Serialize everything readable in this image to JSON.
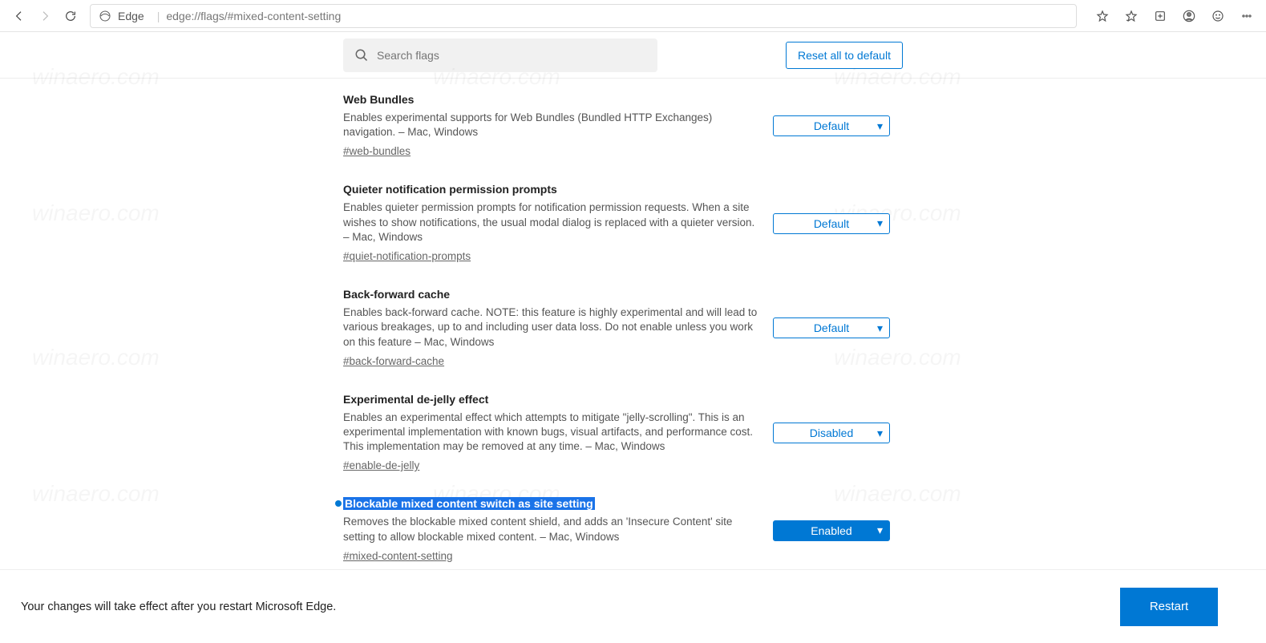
{
  "chrome": {
    "browser_label": "Edge",
    "url": "edge://flags/#mixed-content-setting"
  },
  "toolbar": {
    "search_placeholder": "Search flags",
    "reset_label": "Reset all to default"
  },
  "flags": [
    {
      "title": "Web Bundles",
      "desc": "Enables experimental supports for Web Bundles (Bundled HTTP Exchanges) navigation. – Mac, Windows",
      "anchor": "#web-bundles",
      "value": "Default",
      "highlight": false,
      "enabled_style": false
    },
    {
      "title": "Quieter notification permission prompts",
      "desc": "Enables quieter permission prompts for notification permission requests. When a site wishes to show notifications, the usual modal dialog is replaced with a quieter version. – Mac, Windows",
      "anchor": "#quiet-notification-prompts",
      "value": "Default",
      "highlight": false,
      "enabled_style": false
    },
    {
      "title": "Back-forward cache",
      "desc": "Enables back-forward cache. NOTE: this feature is highly experimental and will lead to various breakages, up to and including user data loss. Do not enable unless you work on this feature – Mac, Windows",
      "anchor": "#back-forward-cache",
      "value": "Default",
      "highlight": false,
      "enabled_style": false
    },
    {
      "title": "Experimental de-jelly effect",
      "desc": "Enables an experimental effect which attempts to mitigate \"jelly-scrolling\". This is an experimental implementation with known bugs, visual artifacts, and performance cost. This implementation may be removed at any time. – Mac, Windows",
      "anchor": "#enable-de-jelly",
      "value": "Disabled",
      "highlight": false,
      "enabled_style": false
    },
    {
      "title": "Blockable mixed content switch as site setting",
      "desc": "Removes the blockable mixed content shield, and adds an 'Insecure Content' site setting to allow blockable mixed content. – Mac, Windows",
      "anchor": "#mixed-content-setting",
      "value": "Enabled",
      "highlight": true,
      "enabled_style": true
    }
  ],
  "footer": {
    "message": "Your changes will take effect after you restart Microsoft Edge.",
    "restart_label": "Restart"
  }
}
